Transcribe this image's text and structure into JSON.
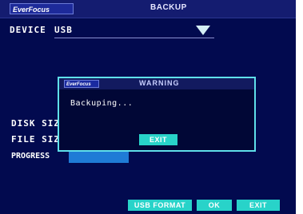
{
  "header": {
    "logo": "EverFocus",
    "title": "BACKUP"
  },
  "form": {
    "device_label": "DEVICE",
    "device_value": "USB",
    "disk_size_label": "DISK SIZ",
    "file_size_label": "FILE SIZ",
    "progress_label": "PROGRESS",
    "progress_percent": 50
  },
  "dialog": {
    "logo": "EverFocus",
    "title": "WARNING",
    "message": "Backuping...",
    "exit_label": "EXIT"
  },
  "buttons": {
    "usb_format": "USB FORMAT",
    "ok": "OK",
    "exit": "EXIT"
  },
  "colors": {
    "background": "#020a4f",
    "accent": "#28d3c9",
    "progress": "#1f7bd6"
  }
}
